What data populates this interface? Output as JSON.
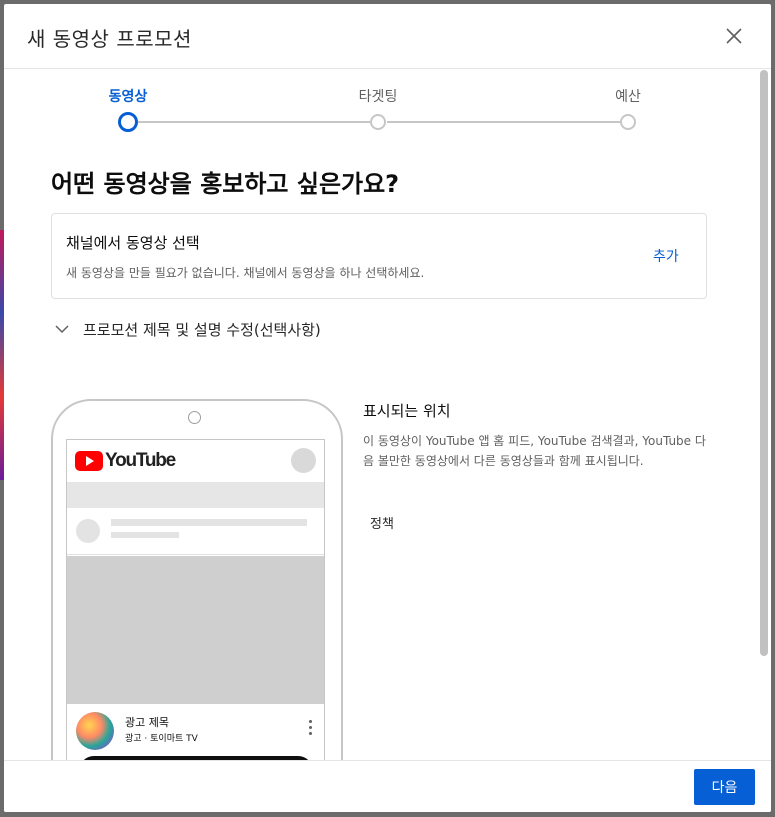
{
  "dialog": {
    "title": "새 동영상 프로모션"
  },
  "stepper": {
    "steps": [
      {
        "label": "동영상",
        "active": true
      },
      {
        "label": "타겟팅",
        "active": false
      },
      {
        "label": "예산",
        "active": false
      }
    ]
  },
  "main": {
    "question": "어떤 동영상을 홍보하고 싶은가요?",
    "card": {
      "title": "채널에서 동영상 선택",
      "description": "새 동영상을 만들 필요가 없습니다. 채널에서 동영상을 하나 선택하세요.",
      "add_label": "추가"
    },
    "edit_toggle_label": "프로모션 제목 및 설명 수정(선택사항)"
  },
  "preview": {
    "logo_text": "YouTube",
    "ad_title": "광고 제목",
    "ad_subtitle": "광고 · 토이마트 TV"
  },
  "info": {
    "title": "표시되는 위치",
    "description": "이 동영상이 YouTube 앱 홈 피드, YouTube 검색결과, YouTube 다음 볼만한 동영상에서 다른 동영상들과 함께 표시됩니다.",
    "policy_label": "정책"
  },
  "footer": {
    "next_label": "다음"
  },
  "colors": {
    "accent": "#065fd4",
    "youtube_red": "#ff0000"
  }
}
